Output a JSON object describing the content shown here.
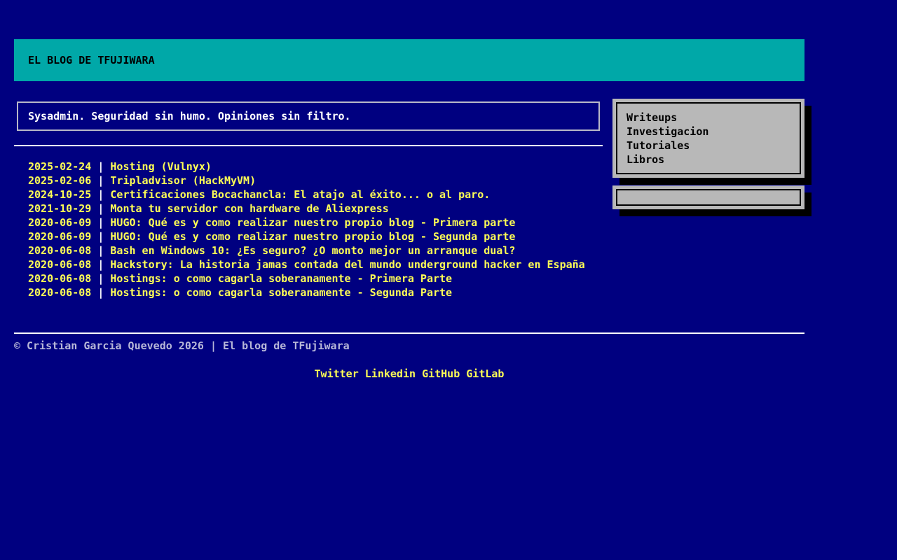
{
  "site": {
    "title": "EL BLOG DE TFUJIWARA",
    "tagline": "Sysadmin. Seguridad sin humo. Opiniones sin filtro."
  },
  "posts": [
    {
      "date": "2025-02-24",
      "title": "Hosting (Vulnyx)"
    },
    {
      "date": "2025-02-06",
      "title": "Tripladvisor (HackMyVM)"
    },
    {
      "date": "2024-10-25",
      "title": "Certificaciones Bocachancla: El atajo al éxito... o al paro."
    },
    {
      "date": "2021-10-29",
      "title": "Monta tu servidor con hardware de Aliexpress"
    },
    {
      "date": "2020-06-09",
      "title": "HUGO: Qué es y como realizar nuestro propio blog - Primera parte"
    },
    {
      "date": "2020-06-09",
      "title": "HUGO: Qué es y como realizar nuestro propio blog - Segunda parte"
    },
    {
      "date": "2020-06-08",
      "title": "Bash en Windows 10: ¿Es seguro? ¿O monto mejor un arranque dual?"
    },
    {
      "date": "2020-06-08",
      "title": "Hackstory: La historia jamas contada del mundo underground hacker en España"
    },
    {
      "date": "2020-06-08",
      "title": "Hostings: o como cagarla soberanamente - Primera Parte"
    },
    {
      "date": "2020-06-08",
      "title": "Hostings: o como cagarla soberanamente - Segunda Parte"
    }
  ],
  "post_separator": "|",
  "sidebar": {
    "menu": [
      "Writeups",
      "Investigacion",
      "Tutoriales",
      "Libros"
    ],
    "search_value": ""
  },
  "footer": {
    "copyright": "© Cristian Garcia Quevedo 2026 | El blog de TFujiwara",
    "social": [
      "Twitter",
      "Linkedin",
      "GitHub",
      "GitLab"
    ]
  },
  "colors": {
    "background": "#000080",
    "header": "#00a8a8",
    "link": "#ffff55",
    "panel": "#b8b8b8"
  }
}
